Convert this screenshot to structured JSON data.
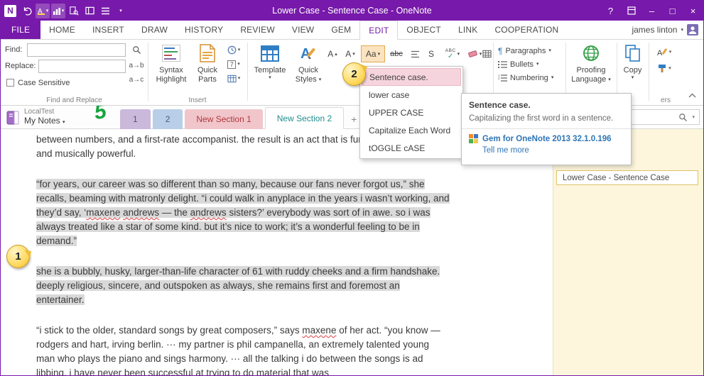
{
  "titlebar": {
    "logo": "N",
    "title": "Lower Case - Sentence Case - OneNote",
    "help": "?"
  },
  "icons": {
    "chevron_down": "▾",
    "small_up": "▴",
    "small_down": "▾",
    "minimize": "–",
    "maximize": "□",
    "close": "×",
    "check": "✓",
    "paragraph": "¶"
  },
  "tabs": [
    {
      "label": "FILE"
    },
    {
      "label": "HOME"
    },
    {
      "label": "INSERT"
    },
    {
      "label": "DRAW"
    },
    {
      "label": "HISTORY"
    },
    {
      "label": "REVIEW"
    },
    {
      "label": "VIEW"
    },
    {
      "label": "GEM"
    },
    {
      "label": "EDIT",
      "active": true
    },
    {
      "label": "OBJECT"
    },
    {
      "label": "LINK"
    },
    {
      "label": "COOPERATION"
    }
  ],
  "user": {
    "name": "james linton"
  },
  "ribbon": {
    "find": {
      "find_label": "Find:",
      "replace_label": "Replace:",
      "replace_glyph1": "a→b",
      "replace_glyph2": "a→c",
      "case_sensitive": "Case Sensitive",
      "group_label": "Find and Replace"
    },
    "insert": {
      "syntax_line1": "Syntax",
      "syntax_line2": "Highlight",
      "quick_line1": "Quick",
      "quick_line2": "Parts",
      "seven": "7",
      "group_label": "Insert"
    },
    "format": {
      "template": "Template",
      "quick1": "Quick",
      "quick2": "Styles",
      "grow": "A",
      "shrink": "A",
      "case_btn": "Aa",
      "strike": "abc",
      "s_label": "S",
      "spell": "ABC"
    },
    "paragraph": {
      "paragraphs": "Paragraphs",
      "bullets": "Bullets",
      "numbering": "Numbering"
    },
    "proofing": {
      "line1": "Proofing",
      "line2": "Language"
    },
    "copy": {
      "label": "Copy"
    },
    "others_label": "ers"
  },
  "case_menu": {
    "items": [
      {
        "label": "Sentence case.",
        "selected": true
      },
      {
        "label": "lower case",
        "selected": false
      },
      {
        "label": "UPPER CASE",
        "selected": false
      },
      {
        "label": "Capitalize Each Word",
        "selected": false
      },
      {
        "label": "tOGGLE cASE",
        "selected": false
      }
    ]
  },
  "tooltip": {
    "title": "Sentence case.",
    "description": "Capitalizing the first word in a sentence.",
    "link": "Gem for OneNote 2013 32.1.0.196",
    "more": "Tell me more"
  },
  "notebook": {
    "line1": "LocalTest",
    "line2": "My Notes",
    "annotation": "5"
  },
  "sections": [
    {
      "label": "1"
    },
    {
      "label": "2"
    },
    {
      "label": "New Section 1"
    },
    {
      "label": "New Section 2",
      "active": true
    },
    {
      "label": "+"
    }
  ],
  "page_panel": {
    "page_title": "Lower Case - Sentence Case"
  },
  "content": {
    "p1": "between numbers, and a first-rate accompanist. the result is an act that is funny, warm, moving, and musically powerful.",
    "p2": "“for years, our career was so different than so many, because our fans never forgot us,” she recalls, beaming with matronly delight. “i could walk in anyplace in the years i wasn’t working, and they’d say, ‘maxene andrews — the andrews sisters?’ everybody was sort of in awe. so i was always treated like a star of some kind. but it’s nice to work; it’s a wonderful feeling to be in demand.”",
    "p3": "she is a bubbly, husky, larger-than-life character of 61 with ruddy cheeks and a firm handshake. deeply religious, sincere, and outspoken as always, she remains first and foremost an entertainer.",
    "p4": "“i stick to the older, standard songs by great composers,” says maxene of her act. “you know — rodgers and hart, irving berlin. ··· my partner is phil campanella, an extremely talented young man who plays the piano and sings harmony. ··· all the talking i do between the songs is ad libbing. i have never been successful at trying to do material that was",
    "misspelled": [
      "maxene",
      "andrews"
    ]
  },
  "callouts": {
    "one": "1",
    "two": "2"
  },
  "colors": {
    "accent": "#7719AA",
    "selection_gray": "#D9D9D9",
    "menu_highlight": "#F6D4DE",
    "pressed_orange": "#FBE3C0",
    "panel_cream": "#FDF6DC",
    "section1": "#CBB9DC",
    "section2": "#B9CFE8",
    "section3": "#F0C6CB",
    "section4_text": "#1F8E8E",
    "callout_yellow": "#FFD95E",
    "annotation_green": "#17A33E",
    "link_blue": "#2E75B6"
  }
}
